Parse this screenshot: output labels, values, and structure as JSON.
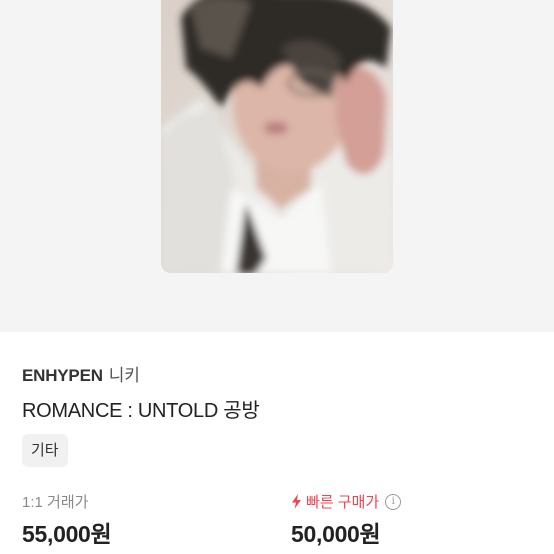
{
  "product": {
    "brand": "ENHYPEN",
    "member": "니키",
    "title": "ROMANCE : UNTOLD 공방",
    "category": "기타"
  },
  "pricing": {
    "trade_label": "1:1 거래가",
    "trade_price": "55,000원",
    "fast_label": "빠른 구매가",
    "fast_price": "50,000원",
    "info_symbol": "i",
    "accent_color": "#ef4552"
  },
  "image": {
    "icon": "photocard-image"
  }
}
